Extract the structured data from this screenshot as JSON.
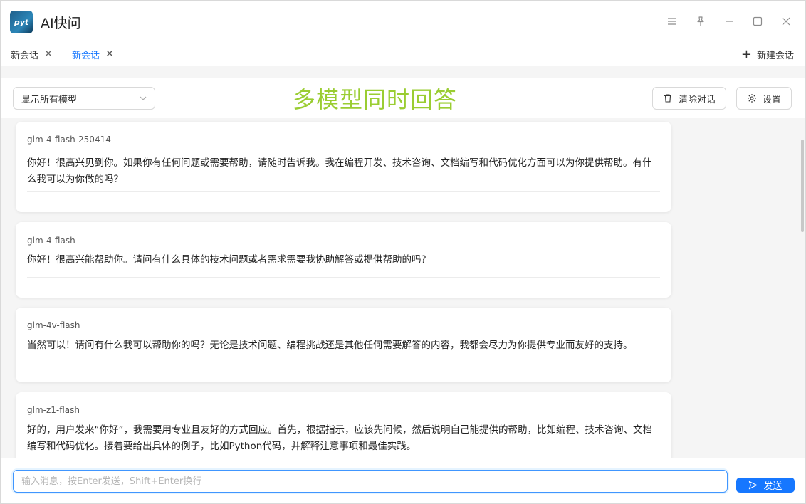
{
  "app": {
    "title": "AI快问",
    "logo_text": "pyt"
  },
  "tabs": [
    {
      "label": "新会话",
      "active": false
    },
    {
      "label": "新会话",
      "active": true
    }
  ],
  "new_chat_label": "新建会话",
  "toolbar": {
    "model_select_value": "显示所有模型",
    "headline": "多模型同时回答",
    "clear_label": "清除对话",
    "settings_label": "设置"
  },
  "responses": [
    {
      "model": "glm-4-flash-250414",
      "text": "你好！很高兴见到你。如果你有任何问题或需要帮助，请随时告诉我。我在编程开发、技术咨询、文档编写和代码优化方面可以为你提供帮助。有什么我可以为你做的吗？"
    },
    {
      "model": "glm-4-flash",
      "text": "你好！很高兴能帮助你。请问有什么具体的技术问题或者需求需要我协助解答或提供帮助的吗？"
    },
    {
      "model": "glm-4v-flash",
      "text": "当然可以！请问有什么我可以帮助你的吗？无论是技术问题、编程挑战还是其他任何需要解答的内容，我都会尽力为你提供专业而友好的支持。"
    },
    {
      "model": "glm-z1-flash",
      "text": "好的，用户发来“你好”，我需要用专业且友好的方式回应。首先，根据指示，应该先问候，然后说明自己能提供的帮助，比如编程、技术咨询、文档编写和代码优化。接着要给出具体的例子，比如Python代码，并解释注意事项和最佳实践。"
    }
  ],
  "input": {
    "placeholder": "输入消息，按Enter发送，Shift+Enter换行",
    "value": ""
  },
  "send_label": "发送",
  "colors": {
    "accent": "#1677ff",
    "headline": "#9acd32",
    "content_bg": "#f5f5f5"
  }
}
